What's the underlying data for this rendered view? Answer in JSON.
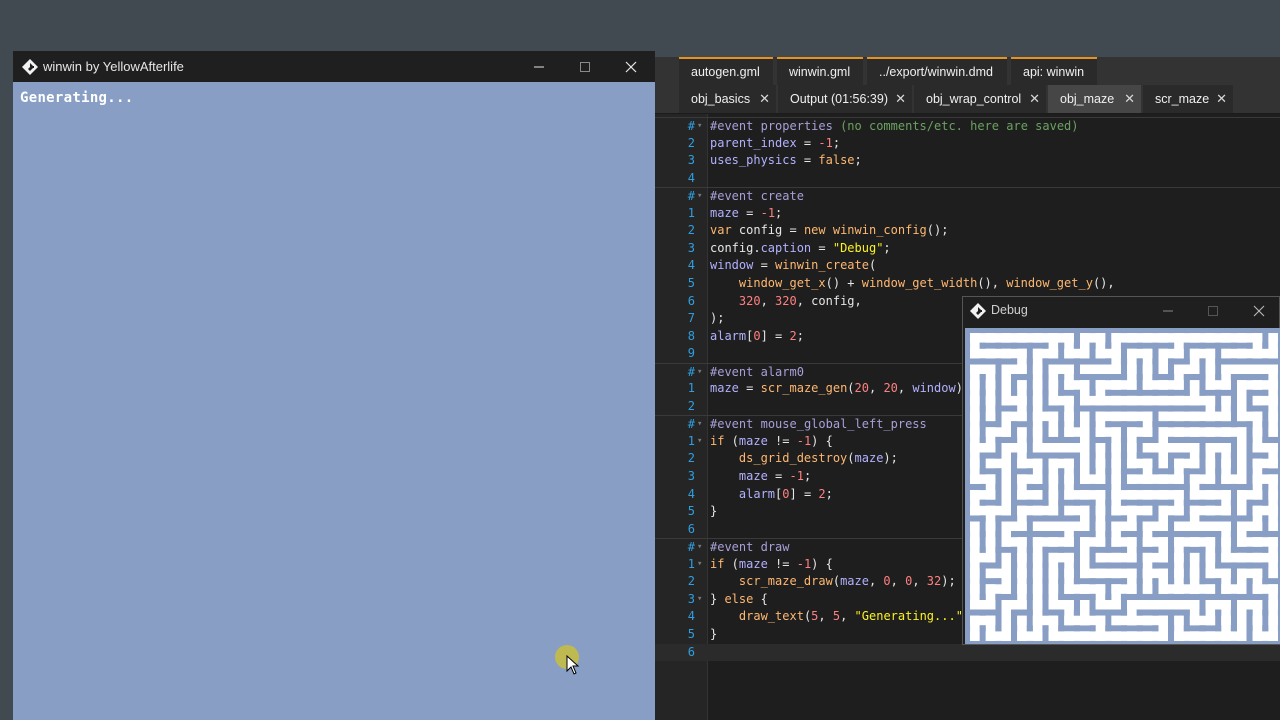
{
  "main_window": {
    "title": "winwin by YellowAfterlife",
    "client_text": "Generating...",
    "client_color": "#889ec5"
  },
  "editor": {
    "tabs_row1": [
      {
        "label": "autogen.gml"
      },
      {
        "label": "winwin.gml"
      },
      {
        "label": "../export/winwin.dmd"
      },
      {
        "label": "api: winwin"
      }
    ],
    "tabs_row2": [
      {
        "label": "obj_basics",
        "close": "✕"
      },
      {
        "label": "Output (01:56:39)",
        "close": "✕"
      },
      {
        "label": "obj_wrap_control",
        "close": "✕"
      },
      {
        "label": "obj_maze",
        "close": "✕",
        "active": true
      },
      {
        "label": "scr_maze",
        "close": "✕"
      }
    ],
    "accent_color": "#e8921e"
  },
  "code_lines": [
    {
      "num": "#",
      "fold": "▾",
      "sep": true
    },
    {
      "num": "2"
    },
    {
      "num": "3"
    },
    {
      "num": "4"
    },
    {
      "num": "#",
      "fold": "▾",
      "sep": true
    },
    {
      "num": "1"
    },
    {
      "num": "2"
    },
    {
      "num": "3"
    },
    {
      "num": "4"
    },
    {
      "num": "5"
    },
    {
      "num": "6"
    },
    {
      "num": "7"
    },
    {
      "num": "8"
    },
    {
      "num": "9"
    },
    {
      "num": "#",
      "fold": "▾",
      "sep": true
    },
    {
      "num": "1"
    },
    {
      "num": "2"
    },
    {
      "num": "#",
      "fold": "▾",
      "sep": true
    },
    {
      "num": "1",
      "fold": "▾"
    },
    {
      "num": "2"
    },
    {
      "num": "3"
    },
    {
      "num": "4"
    },
    {
      "num": "5"
    },
    {
      "num": "6"
    },
    {
      "num": "#",
      "fold": "▾",
      "sep": true
    },
    {
      "num": "1",
      "fold": "▾"
    },
    {
      "num": "2"
    },
    {
      "num": "3",
      "fold": "▾"
    },
    {
      "num": "4"
    },
    {
      "num": "5"
    },
    {
      "num": "6",
      "current": true
    }
  ],
  "code_tokens": [
    [
      [
        "ev",
        "#event"
      ],
      [
        "pl",
        " "
      ],
      [
        "ev",
        "properties"
      ],
      [
        "pl",
        " "
      ],
      [
        "cm",
        "(no comments/etc. here are saved)"
      ]
    ],
    [
      [
        "var",
        "parent_index"
      ],
      [
        "pl",
        " = "
      ],
      [
        "num",
        "-1"
      ],
      [
        "pl",
        ";"
      ]
    ],
    [
      [
        "var",
        "uses_physics"
      ],
      [
        "pl",
        " = "
      ],
      [
        "kw",
        "false"
      ],
      [
        "pl",
        ";"
      ]
    ],
    [],
    [
      [
        "ev",
        "#event"
      ],
      [
        "pl",
        " "
      ],
      [
        "ev",
        "create"
      ]
    ],
    [
      [
        "var",
        "maze"
      ],
      [
        "pl",
        " = "
      ],
      [
        "num",
        "-1"
      ],
      [
        "pl",
        ";"
      ]
    ],
    [
      [
        "kw",
        "var"
      ],
      [
        "pl",
        " config = "
      ],
      [
        "kw",
        "new"
      ],
      [
        "pl",
        " "
      ],
      [
        "fn",
        "winwin_config"
      ],
      [
        "pl",
        "();"
      ]
    ],
    [
      [
        "pl",
        "config."
      ],
      [
        "var",
        "caption"
      ],
      [
        "pl",
        " = "
      ],
      [
        "str",
        "\"Debug\""
      ],
      [
        "pl",
        ";"
      ]
    ],
    [
      [
        "var",
        "window"
      ],
      [
        "pl",
        " = "
      ],
      [
        "fn",
        "winwin_create"
      ],
      [
        "pl",
        "("
      ]
    ],
    [
      [
        "pl",
        "    "
      ],
      [
        "fn",
        "window_get_x"
      ],
      [
        "pl",
        "() + "
      ],
      [
        "fn",
        "window_get_width"
      ],
      [
        "pl",
        "(), "
      ],
      [
        "fn",
        "window_get_y"
      ],
      [
        "pl",
        "(),"
      ]
    ],
    [
      [
        "pl",
        "    "
      ],
      [
        "num",
        "320"
      ],
      [
        "pl",
        ", "
      ],
      [
        "num",
        "320"
      ],
      [
        "pl",
        ", config,"
      ]
    ],
    [
      [
        "pl",
        ");"
      ]
    ],
    [
      [
        "var",
        "alarm"
      ],
      [
        "pl",
        "["
      ],
      [
        "num",
        "0"
      ],
      [
        "pl",
        "] = "
      ],
      [
        "num",
        "2"
      ],
      [
        "pl",
        ";"
      ]
    ],
    [],
    [
      [
        "ev",
        "#event"
      ],
      [
        "pl",
        " "
      ],
      [
        "ev",
        "alarm0"
      ]
    ],
    [
      [
        "var",
        "maze"
      ],
      [
        "pl",
        " = "
      ],
      [
        "fn",
        "scr_maze_gen"
      ],
      [
        "pl",
        "("
      ],
      [
        "num",
        "20"
      ],
      [
        "pl",
        ", "
      ],
      [
        "num",
        "20"
      ],
      [
        "pl",
        ", "
      ],
      [
        "var",
        "window"
      ],
      [
        "pl",
        ")"
      ]
    ],
    [],
    [
      [
        "ev",
        "#event"
      ],
      [
        "pl",
        " "
      ],
      [
        "ev",
        "mouse_global_left_press"
      ]
    ],
    [
      [
        "kw",
        "if"
      ],
      [
        "pl",
        " ("
      ],
      [
        "var",
        "maze"
      ],
      [
        "pl",
        " != "
      ],
      [
        "num",
        "-1"
      ],
      [
        "pl",
        ") {"
      ]
    ],
    [
      [
        "pl",
        "    "
      ],
      [
        "fn",
        "ds_grid_destroy"
      ],
      [
        "pl",
        "("
      ],
      [
        "var",
        "maze"
      ],
      [
        "pl",
        ");"
      ]
    ],
    [
      [
        "pl",
        "    "
      ],
      [
        "var",
        "maze"
      ],
      [
        "pl",
        " = "
      ],
      [
        "num",
        "-1"
      ],
      [
        "pl",
        ";"
      ]
    ],
    [
      [
        "pl",
        "    "
      ],
      [
        "var",
        "alarm"
      ],
      [
        "pl",
        "["
      ],
      [
        "num",
        "0"
      ],
      [
        "pl",
        "] = "
      ],
      [
        "num",
        "2"
      ],
      [
        "pl",
        ";"
      ]
    ],
    [
      [
        "pl",
        "}"
      ]
    ],
    [],
    [
      [
        "ev",
        "#event"
      ],
      [
        "pl",
        " "
      ],
      [
        "ev",
        "draw"
      ]
    ],
    [
      [
        "kw",
        "if"
      ],
      [
        "pl",
        " ("
      ],
      [
        "var",
        "maze"
      ],
      [
        "pl",
        " != "
      ],
      [
        "num",
        "-1"
      ],
      [
        "pl",
        ") {"
      ]
    ],
    [
      [
        "pl",
        "    "
      ],
      [
        "fn",
        "scr_maze_draw"
      ],
      [
        "pl",
        "("
      ],
      [
        "var",
        "maze"
      ],
      [
        "pl",
        ", "
      ],
      [
        "num",
        "0"
      ],
      [
        "pl",
        ", "
      ],
      [
        "num",
        "0"
      ],
      [
        "pl",
        ", "
      ],
      [
        "num",
        "32"
      ],
      [
        "pl",
        ");"
      ]
    ],
    [
      [
        "pl",
        "} "
      ],
      [
        "kw",
        "else"
      ],
      [
        "pl",
        " {"
      ]
    ],
    [
      [
        "pl",
        "    "
      ],
      [
        "fn",
        "draw_text"
      ],
      [
        "pl",
        "("
      ],
      [
        "num",
        "5"
      ],
      [
        "pl",
        ", "
      ],
      [
        "num",
        "5"
      ],
      [
        "pl",
        ", "
      ],
      [
        "str",
        "\"Generating...\""
      ]
    ],
    [
      [
        "pl",
        "}"
      ]
    ],
    []
  ],
  "debug_window": {
    "title": "Debug",
    "maze_wall_color": "#889ec5",
    "maze_path_color": "#ffffff"
  }
}
